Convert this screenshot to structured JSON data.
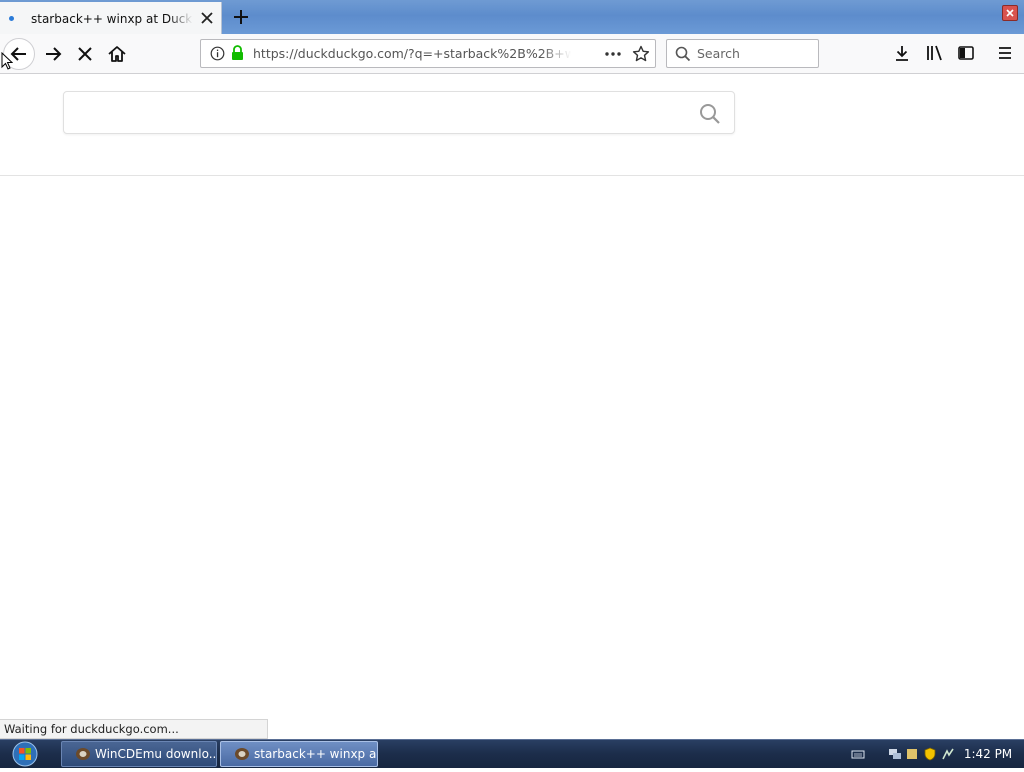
{
  "browser": {
    "tab": {
      "title": "starback++ winxp at DuckDuckGo"
    },
    "url": "https://duckduckgo.com/?q=+starback%2B%2B+winxp",
    "search_placeholder": "Search",
    "status": "Waiting for duckduckgo.com..."
  },
  "page": {
    "search_query": ""
  },
  "taskbar": {
    "items": [
      {
        "label": "WinCDEmu downlo..."
      },
      {
        "label": "starback++ winxp a..."
      }
    ],
    "clock": "1:42 PM"
  },
  "colors": {
    "titlebar": "#6f9bd3",
    "taskbar": "#1c2d4a",
    "lock_green": "#12bc00",
    "loading_dot": "#2b7bd8"
  },
  "icons": [
    "back-arrow-icon",
    "forward-arrow-icon",
    "stop-icon",
    "home-icon",
    "info-icon",
    "lock-icon",
    "more-icon",
    "star-icon",
    "search-icon",
    "download-icon",
    "library-icon",
    "sidebar-icon",
    "hamburger-menu-icon",
    "close-icon",
    "plus-icon"
  ]
}
